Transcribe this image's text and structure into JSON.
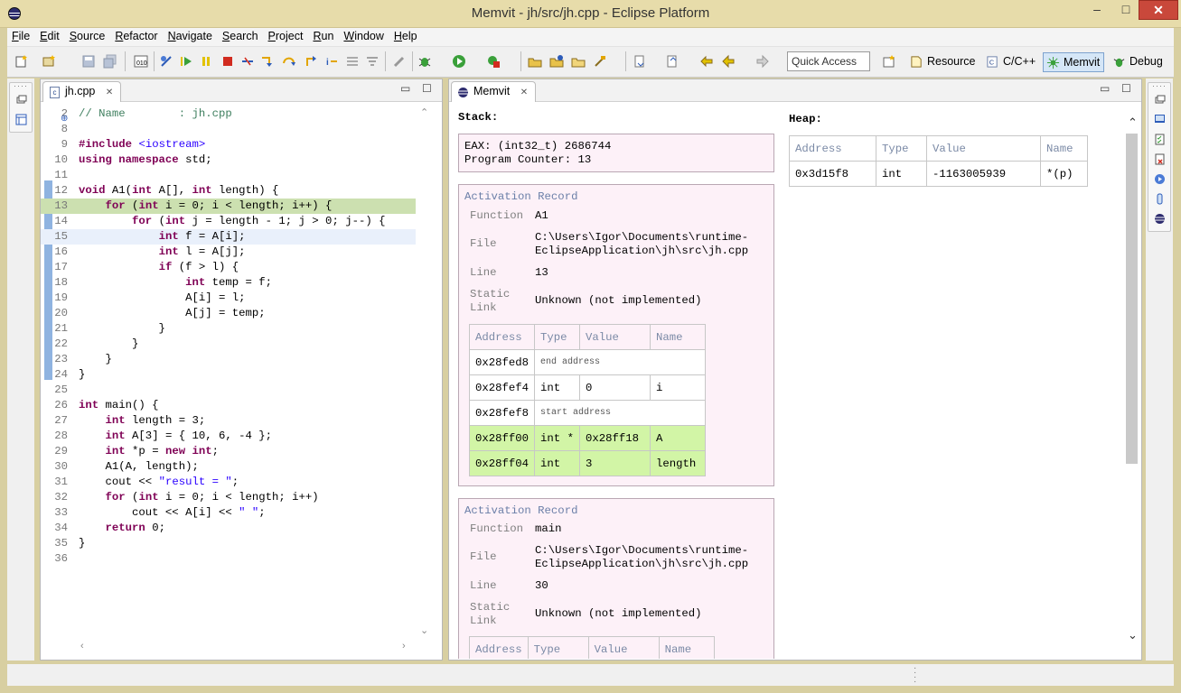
{
  "window": {
    "title": "Memvit - jh/src/jh.cpp - Eclipse Platform",
    "min": "–",
    "max": "□",
    "close": "✕"
  },
  "menu": [
    "File",
    "Edit",
    "Source",
    "Refactor",
    "Navigate",
    "Search",
    "Project",
    "Run",
    "Window",
    "Help"
  ],
  "toolbar": {
    "quick_access": "Quick Access",
    "perspectives": [
      "Resource",
      "C/C++",
      "Memvit",
      "Debug"
    ]
  },
  "editor": {
    "tab": "jh.cpp",
    "file_badge": "c",
    "lines": [
      {
        "n": "2",
        "html": "<span class=\"cm\">// Name        : jh.cpp</span>"
      },
      {
        "n": "8",
        "html": ""
      },
      {
        "n": "9",
        "html": "<span class=\"kw\">#include</span> <span class=\"st\">&lt;iostream&gt;</span>"
      },
      {
        "n": "10",
        "html": "<span class=\"kw\">using namespace</span> std;"
      },
      {
        "n": "11",
        "html": ""
      },
      {
        "n": "12",
        "html": "<span class=\"kw\">void</span> A1(<span class=\"kw\">int</span> A[], <span class=\"kw\">int</span> length) {"
      },
      {
        "n": "13",
        "html": "    <span class=\"kw\">for</span> (<span class=\"kw\">int</span> i = 0; i &lt; length; i++) {"
      },
      {
        "n": "14",
        "html": "        <span class=\"kw\">for</span> (<span class=\"kw\">int</span> j = length - 1; j &gt; 0; j--) {"
      },
      {
        "n": "15",
        "html": "            <span class=\"kw\">int</span> f = A[i];"
      },
      {
        "n": "16",
        "html": "            <span class=\"kw\">int</span> l = A[j];"
      },
      {
        "n": "17",
        "html": "            <span class=\"kw\">if</span> (f &gt; l) {"
      },
      {
        "n": "18",
        "html": "                <span class=\"kw\">int</span> temp = f;"
      },
      {
        "n": "19",
        "html": "                A[i] = l;"
      },
      {
        "n": "20",
        "html": "                A[j] = temp;"
      },
      {
        "n": "21",
        "html": "            }"
      },
      {
        "n": "22",
        "html": "        }"
      },
      {
        "n": "23",
        "html": "    }"
      },
      {
        "n": "24",
        "html": "}"
      },
      {
        "n": "25",
        "html": ""
      },
      {
        "n": "26",
        "html": "<span class=\"kw\">int</span> main() {"
      },
      {
        "n": "27",
        "html": "    <span class=\"kw\">int</span> length = 3;"
      },
      {
        "n": "28",
        "html": "    <span class=\"kw\">int</span> A[3] = { 10, 6, -4 };"
      },
      {
        "n": "29",
        "html": "    <span class=\"kw\">int</span> *p = <span class=\"kw\">new int</span>;"
      },
      {
        "n": "30",
        "html": "    A1(A, length);"
      },
      {
        "n": "31",
        "html": "    cout &lt;&lt; <span class=\"st\">\"result = \"</span>;"
      },
      {
        "n": "32",
        "html": "    <span class=\"kw\">for</span> (<span class=\"kw\">int</span> i = 0; i &lt; length; i++)"
      },
      {
        "n": "33",
        "html": "        cout &lt;&lt; A[i] &lt;&lt; <span class=\"st\">\" \"</span>;"
      },
      {
        "n": "34",
        "html": "    <span class=\"kw\">return</span> 0;"
      },
      {
        "n": "35",
        "html": "}"
      },
      {
        "n": "36",
        "html": ""
      }
    ]
  },
  "memvit": {
    "tab": "Memvit",
    "stack_label": "Stack:",
    "heap_label": "Heap:",
    "registers": {
      "eax": "EAX: (int32_t) 2686744",
      "pc": "Program Counter: 13"
    },
    "ar_title": "Activation Record",
    "keys": {
      "function": "Function",
      "file": "File",
      "line": "Line",
      "static1": "Static",
      "static2": "Link"
    },
    "records": [
      {
        "function": "A1",
        "file1": "C:\\Users\\Igor\\Documents\\runtime-",
        "file2": "EclipseApplication\\jh\\src\\jh.cpp",
        "line": "13",
        "static_link": "Unknown (not implemented)",
        "headers": [
          "Address",
          "Type",
          "Value",
          "Name"
        ],
        "rows": [
          {
            "addr": "0x28fed8",
            "note": "end address"
          },
          {
            "addr": "0x28fef4",
            "type": "int",
            "value": "0",
            "name": "i"
          },
          {
            "addr": "0x28fef8",
            "note": "start address"
          },
          {
            "addr": "0x28ff00",
            "type": "int *",
            "value": "0x28ff18",
            "name": "A"
          },
          {
            "addr": "0x28ff04",
            "type": "int",
            "value": "3",
            "name": "length"
          }
        ]
      },
      {
        "function": "main",
        "file1": "C:\\Users\\Igor\\Documents\\runtime-",
        "file2": "EclipseApplication\\jh\\src\\jh.cpp",
        "line": "30",
        "static_link": "Unknown (not implemented)",
        "headers": [
          "Address",
          "Type",
          "Value",
          "Name"
        ]
      }
    ],
    "heap": {
      "headers": [
        "Address",
        "Type",
        "Value",
        "Name"
      ],
      "row": {
        "addr": "0x3d15f8",
        "type": "int",
        "value": "-1163005939",
        "name": "*(p)"
      }
    }
  },
  "colors": {
    "highlight_green": "#d2f5a6",
    "record_bg": "#fdf1f8",
    "accent": "#7da2ce"
  }
}
